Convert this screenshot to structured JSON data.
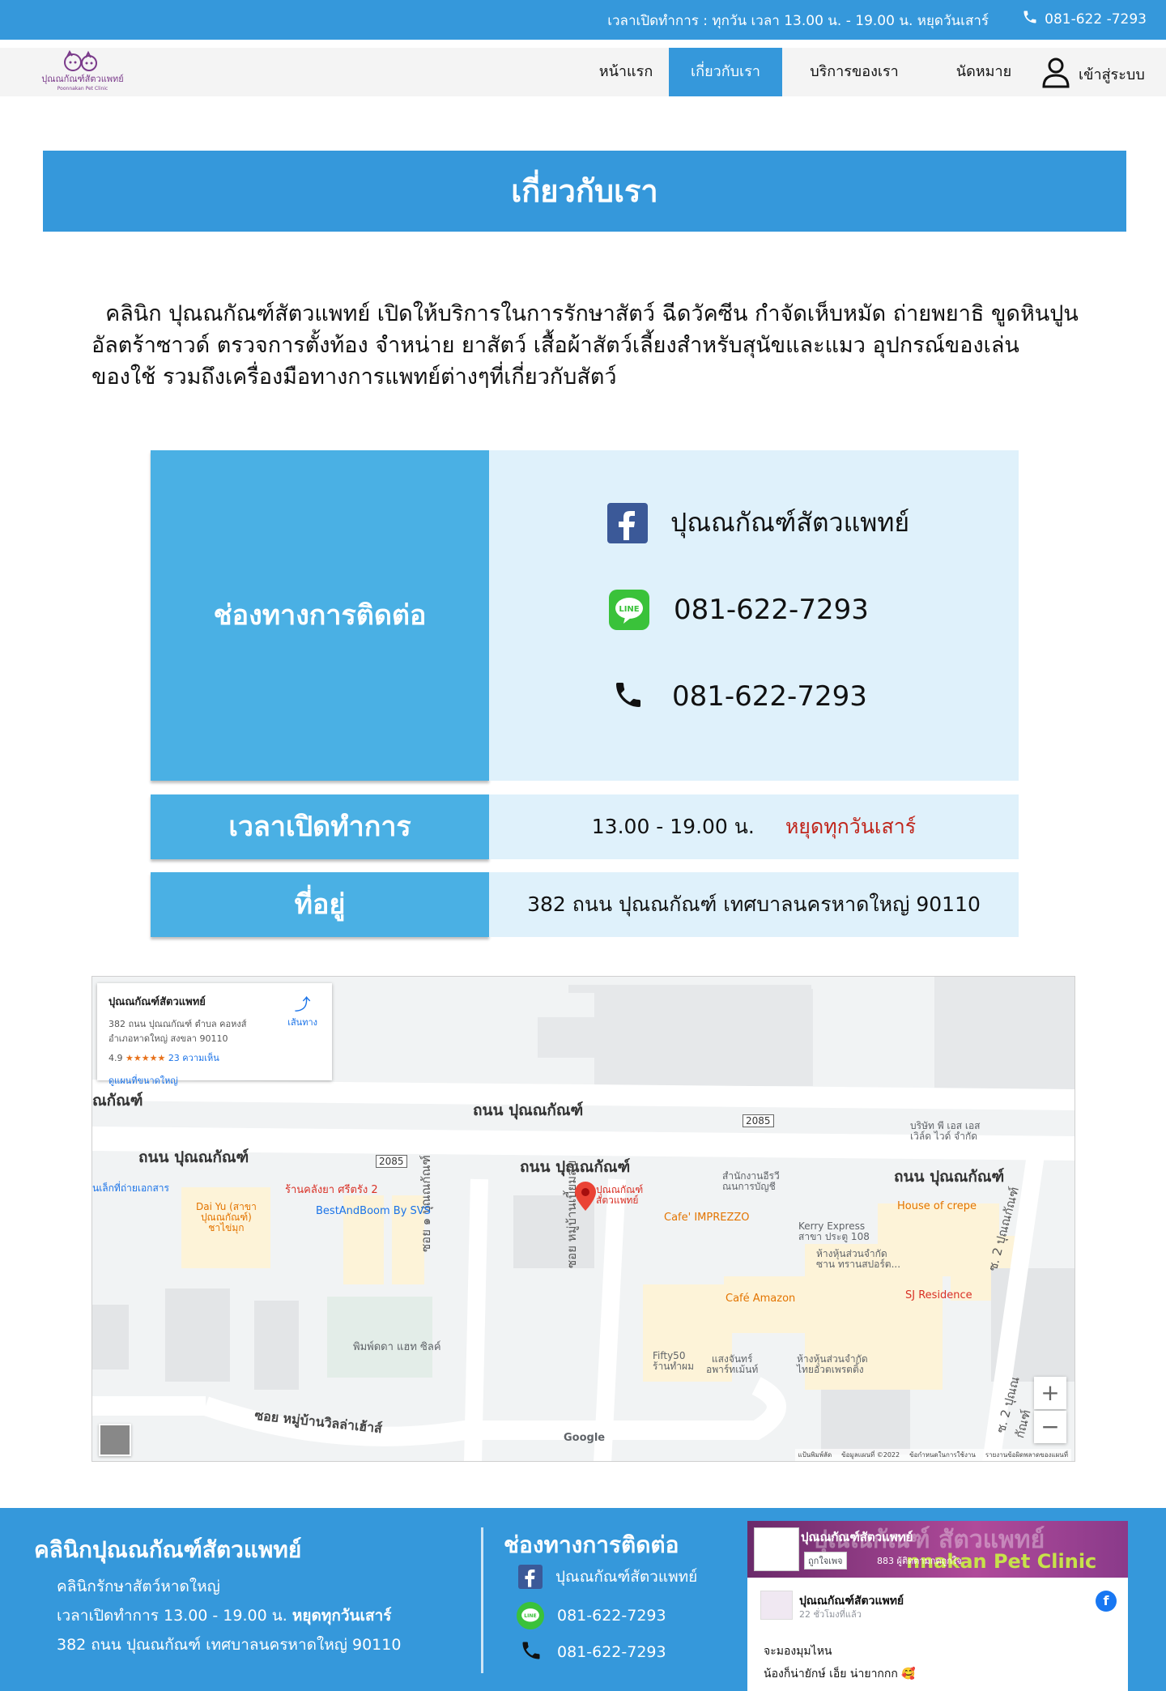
{
  "topbar": {
    "hours": "เวลาเปิดทำการ : ทุกวัน เวลา 13.00 น. - 19.00 น. หยุดวันเสาร์",
    "phone": "081-622 -7293"
  },
  "nav": {
    "logo_text": "ปุณณกัณฑ์สัตวแพทย์",
    "logo_subtext": "Poonnakan Pet Clinic",
    "items": [
      "หน้าแรก",
      "เกี่ยวกับเรา",
      "บริการของเรา",
      "นัดหมาย"
    ],
    "active": "เกี่ยวกับเรา",
    "login": "เข้าสู่ระบบ"
  },
  "page_title": "เกี่ยวกับเรา",
  "intro": "คลินิก ปุณณกัณฑ์สัตวแพทย์ เปิดให้บริการในการรักษาสัตว์ ฉีดวัคซีน กำจัดเห็บหมัด ถ่ายพยาธิ ขูดหินปูน อัลตร้าซาวด์ ตรวจการตั้งท้อง จำหน่าย ยาสัตว์ เสื้อผ้าสัตว์เลี้ยงสำหรับสุนัขและแมว อุปกรณ์ของเล่นของใช้ รวมถึงเครื่องมือทางการแพทย์ต่างๆที่เกี่ยวกับสัตว์",
  "contact": {
    "heading": "ช่องทางการติดต่อ",
    "facebook": "ปุณณกัณฑ์สัตวแพทย์",
    "line": "081-622-7293",
    "phone": "081-622-7293"
  },
  "hours": {
    "heading": "เวลาเปิดทำการ",
    "time": "13.00 - 19.00 น.",
    "closed": "หยุดทุกวันเสาร์",
    "closed_color": "#c0261c"
  },
  "address": {
    "heading": "ที่อยู่",
    "value": "382 ถนน ปุณณกัณฑ์ เทศบาลนครหาดใหญ่ 90110"
  },
  "map": {
    "card_title": "ปุณณกัณฑ์สัตวแพทย์",
    "card_addr1": "382 ถนน ปุณณกัณฑ์ ตำบล คอหงส์",
    "card_addr2": "อำเภอหาดใหญ่ สงขลา 90110",
    "card_rating": "4.9",
    "card_stars": "★★★★★",
    "card_reviews": "23 ความเห็น",
    "card_link": "ดูแผนที่ขนาดใหญ่",
    "directions": "เส้นทาง",
    "roads": [
      "ถนน ปุณณกัณฑ์",
      "ถนน ปุณณกัณฑ์",
      "ถนน ปุณณกัณฑ์",
      "ถนน ปุณณกัณฑ์",
      "ณกัณฑ์"
    ],
    "side_roads": [
      "ซอย ๑ ปุณณกัณฑ์",
      "ซอย หมู่บ้านเบี้ยมสุข",
      "ซ. 2 ปุณณกัณฑ์",
      "ซ. 2 ปุณณกัณฑ์",
      "ซอย หมู่บ้านวิลล่าเฮ้าส์"
    ],
    "route_badges": [
      "2085",
      "2085"
    ],
    "places": [
      {
        "name": "ปุณณกัณฑ์",
        "name2": "สัตวแพทย์",
        "color": "#d93025"
      },
      {
        "name": "ร้านคลังยา ศรีตรัง 2",
        "color": "#d93025"
      },
      {
        "name": "Dai Yu (สาขา",
        "name2": "ปุณณกัณฑ์)",
        "name3": "ชาไข่มุก",
        "color": "#e37400"
      },
      {
        "name": "BestAndBoom By SVS",
        "color": "#1a73e8"
      },
      {
        "name": "Cafe' IMPREZZO",
        "color": "#e37400"
      },
      {
        "name": "สำนักงานอีรวี",
        "name2": "ณนการบัญชี",
        "color": "#5f6368"
      },
      {
        "name": "Kerry Express",
        "name2": "สาขา ประตู 108",
        "color": "#5f6368"
      },
      {
        "name": "House of crepe",
        "color": "#e37400"
      },
      {
        "name": "ห้างหุ้นส่วนจำกัด",
        "name2": "ซาน ทรานสปอร์ต...",
        "color": "#5f6368"
      },
      {
        "name": "SJ Residence",
        "color": "#d93025"
      },
      {
        "name": "Café Amazon",
        "color": "#e37400"
      },
      {
        "name": "พิมพ์ดดา แฮท ซิลค์",
        "color": "#5f6368"
      },
      {
        "name": "Fifty50",
        "name2": "ร้านทำผม",
        "color": "#5f6368"
      },
      {
        "name": "แสงจันทร์",
        "name2": "อพาร์ทเม้นท์",
        "color": "#5f6368"
      },
      {
        "name": "ห้างหุ้นส่วนจำกัด",
        "name2": "ไทยอัวตเพรตติ้ง",
        "color": "#5f6368"
      },
      {
        "name": "บริษัท พี เอส เอส",
        "name2": "เวิล์ด ไวด์ จำกัด",
        "color": "#5f6368"
      },
      {
        "name": "นเล็กที่ถ่ายเอกสาร",
        "color": "#1a73e8"
      }
    ],
    "google": "Google",
    "footer_text": [
      "แป้นพิมพ์ลัด",
      "ข้อมูลแผนที่ ©2022",
      "ข้อกำหนดในการใช้งาน",
      "รายงานข้อผิดพลาดของแผนที่"
    ],
    "zoom_in": "+",
    "zoom_out": "−"
  },
  "footer": {
    "title": "คลินิกปุณณกัณฑ์สัตวแพทย์",
    "line1": "คลินิกรักษาสัตว์หาดใหญ่",
    "line2_prefix": "เวลาเปิดทำการ 13.00 - 19.00 น.",
    "line2_bold": "หยุดทุกวันเสาร์",
    "line3": "382 ถนน ปุณณกัณฑ์ เทศบาลนครหาดใหญ่ 90110",
    "contact_title": "ช่องทางการติดต่อ",
    "facebook": "ปุณณกัณฑ์สัตวแพทย์",
    "line": "081-622-7293",
    "phone": "081-622-7293",
    "fb_page_name": "ปุณณกัณฑ์สัตวแพทย์",
    "fb_like": "ถูกใจเพจ",
    "fb_likes_count": "883 ผู้ติดตามกดถูกใจ",
    "fb_cover_text": "ปุณณกัณฑ์ สัตวแพทย์",
    "fb_cover_sub": "nnakan Pet Clinic",
    "fb_post_name": "ปุณณกัณฑ์สัตวแพทย์",
    "fb_post_time": "22 ชั่วโมงที่แล้ว",
    "fb_post_line1": "จะมองมุมไหน",
    "fb_post_line2": "น้องก็น่ายักษ์ เอ็ย น่ายากกก 🥰"
  },
  "colors": {
    "primary": "#3598db",
    "cell_blue": "#4ab0e4",
    "cell_light": "#dff1fb",
    "line_green": "#3ac23a",
    "facebook_blue": "#3b5998"
  },
  "icons": [
    "phone-icon",
    "user-icon",
    "facebook-icon",
    "line-icon",
    "map-pin-icon",
    "directions-icon"
  ]
}
